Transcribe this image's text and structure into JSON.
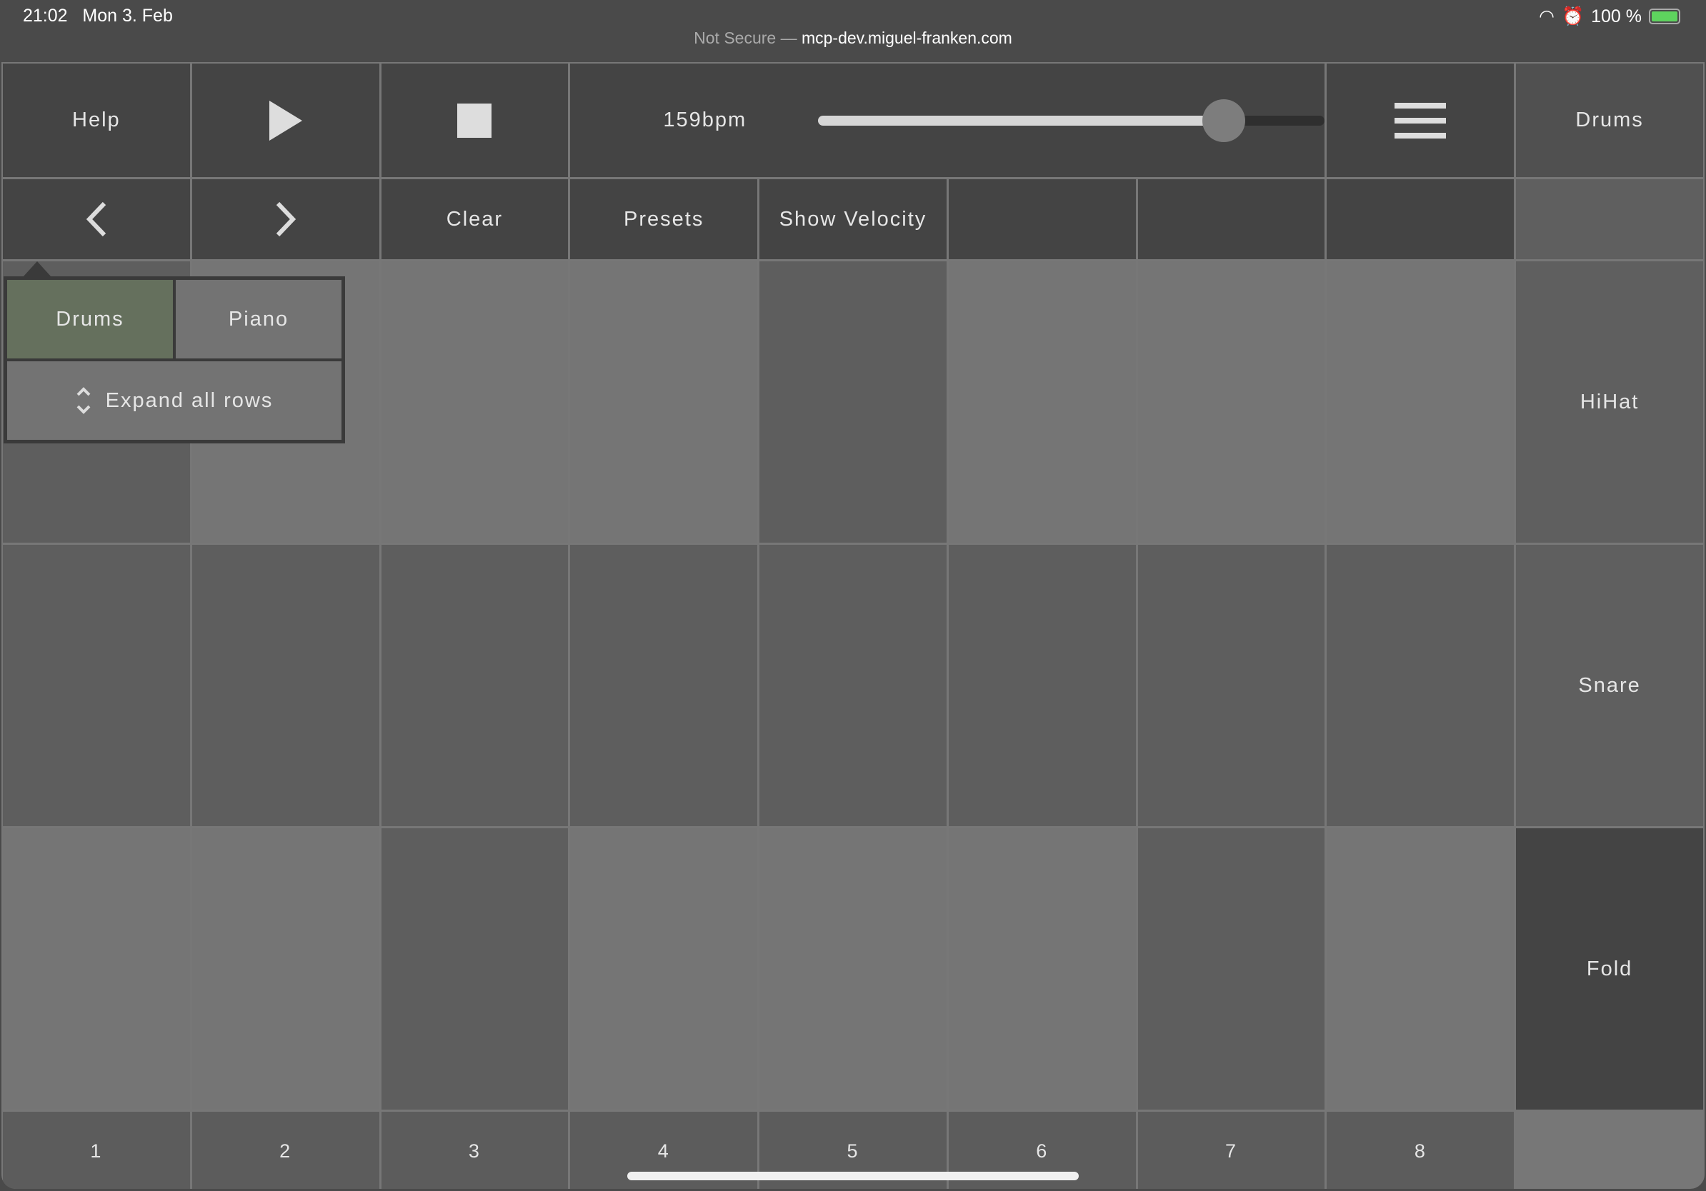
{
  "status_bar": {
    "time": "21:02",
    "date": "Mon 3. Feb",
    "battery": "100 %",
    "url_prefix": "Not Secure —",
    "url": "mcp-dev.miguel-franken.com"
  },
  "toolbar": {
    "help": "Help",
    "bpm": "159bpm",
    "tempo_fraction": 0.8
  },
  "toolbar2": {
    "instrument": "Drums",
    "clear": "Clear",
    "presets": "Presets",
    "show_velocity": "Show Velocity"
  },
  "popover": {
    "options": [
      "Drums",
      "Piano"
    ],
    "selected": "Drums",
    "expand": "Expand all rows"
  },
  "rows": [
    {
      "label": "",
      "cells": [
        0,
        1,
        1,
        1,
        0,
        1,
        1,
        1
      ]
    },
    {
      "label": "HiHat",
      "cells": [
        0,
        0,
        0,
        0,
        0,
        0,
        0,
        0
      ]
    },
    {
      "label": "Snare",
      "cells": [
        1,
        1,
        0,
        1,
        1,
        1,
        0,
        1
      ]
    }
  ],
  "footer": {
    "fold": "Fold",
    "steps": [
      "1",
      "2",
      "3",
      "4",
      "5",
      "6",
      "7",
      "8"
    ]
  }
}
